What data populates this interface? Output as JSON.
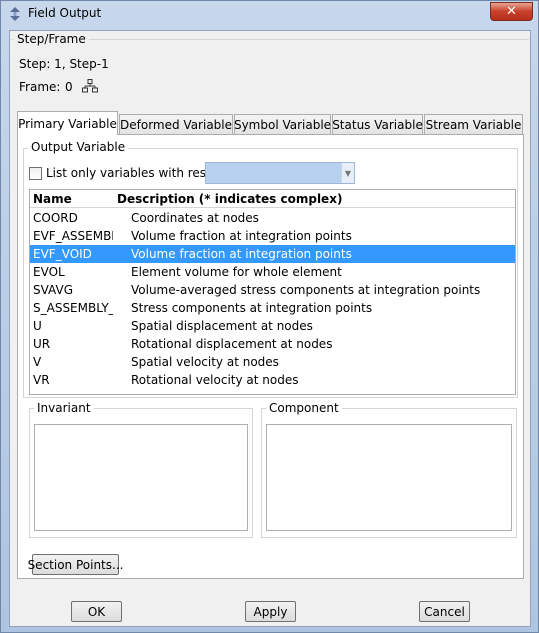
{
  "window": {
    "title": "Field Output",
    "close_label": "✕",
    "app_icon": "abaqus-arrows-icon"
  },
  "step_frame": {
    "group_label": "Step/Frame",
    "step_text": "Step:  1, Step-1",
    "frame_label": "Frame:",
    "frame_value": "0",
    "frame_select_icon": "frame-selector-icon"
  },
  "tabs": [
    {
      "label": "Primary Variable",
      "active": true
    },
    {
      "label": "Deformed Variable",
      "active": false
    },
    {
      "label": "Symbol Variable",
      "active": false
    },
    {
      "label": "Status Variable",
      "active": false
    },
    {
      "label": "Stream Variable",
      "active": false
    }
  ],
  "output_variable": {
    "group_label": "Output Variable",
    "checkbox_label": "List only variables with results:",
    "checkbox_checked": false,
    "filter_value": ""
  },
  "variables_table": {
    "columns": [
      "Name",
      "Description (* indicates complex)"
    ],
    "rows": [
      {
        "name": "COORD",
        "description": "Coordinates at nodes"
      },
      {
        "name": "EVF_ASSEMBLY",
        "description": "Volume fraction at integration points"
      },
      {
        "name": "EVF_VOID",
        "description": "Volume fraction at integration points"
      },
      {
        "name": "EVOL",
        "description": "Element volume for whole element"
      },
      {
        "name": "SVAVG",
        "description": "Volume-averaged stress components at integration points"
      },
      {
        "name": "S_ASSEMBLY_V",
        "description": "Stress components at integration points"
      },
      {
        "name": "U",
        "description": "Spatial displacement at nodes"
      },
      {
        "name": "UR",
        "description": "Rotational displacement at nodes"
      },
      {
        "name": "V",
        "description": "Spatial velocity at nodes"
      },
      {
        "name": "VR",
        "description": "Rotational velocity at nodes"
      }
    ],
    "selected_row": "EVF_VOID"
  },
  "invariant": {
    "group_label": "Invariant"
  },
  "component": {
    "group_label": "Component"
  },
  "buttons": {
    "section_points": "Section Points...",
    "ok": "OK",
    "apply": "Apply",
    "cancel": "Cancel"
  },
  "colors": {
    "selection": "#3399ff",
    "title_bar": "#b9cee7",
    "close_button": "#c7402a"
  }
}
